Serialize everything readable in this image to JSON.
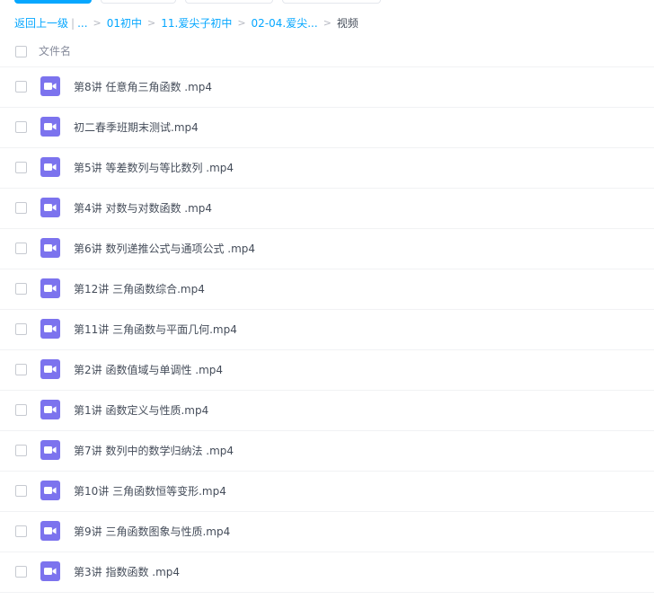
{
  "breadcrumb": {
    "back": "返回上一级",
    "ellipsis": "...",
    "items": [
      "01初中",
      "11.爱尖子初中",
      "02-04.爱尖..."
    ],
    "current": "视频"
  },
  "list_header": {
    "filename_label": "文件名"
  },
  "files": [
    {
      "name": "第8讲 任意角三角函数 .mp4",
      "icon": "video-file-icon"
    },
    {
      "name": "初二春季班期末测试.mp4",
      "icon": "video-file-icon"
    },
    {
      "name": "第5讲 等差数列与等比数列 .mp4",
      "icon": "video-file-icon"
    },
    {
      "name": "第4讲 对数与对数函数 .mp4",
      "icon": "video-file-icon"
    },
    {
      "name": "第6讲 数列递推公式与通项公式 .mp4",
      "icon": "video-file-icon"
    },
    {
      "name": "第12讲 三角函数综合.mp4",
      "icon": "video-file-icon"
    },
    {
      "name": "第11讲 三角函数与平面几何.mp4",
      "icon": "video-file-icon"
    },
    {
      "name": "第2讲 函数值域与单调性 .mp4",
      "icon": "video-file-icon"
    },
    {
      "name": "第1讲 函数定义与性质.mp4",
      "icon": "video-file-icon"
    },
    {
      "name": "第7讲 数列中的数学归纳法 .mp4",
      "icon": "video-file-icon"
    },
    {
      "name": "第10讲 三角函数恒等变形.mp4",
      "icon": "video-file-icon"
    },
    {
      "name": "第9讲 三角函数图象与性质.mp4",
      "icon": "video-file-icon"
    },
    {
      "name": "第3讲 指数函数 .mp4",
      "icon": "video-file-icon"
    }
  ],
  "colors": {
    "accent": "#06a7ff",
    "video_icon": "#7c73ee",
    "text": "#454d5a"
  }
}
